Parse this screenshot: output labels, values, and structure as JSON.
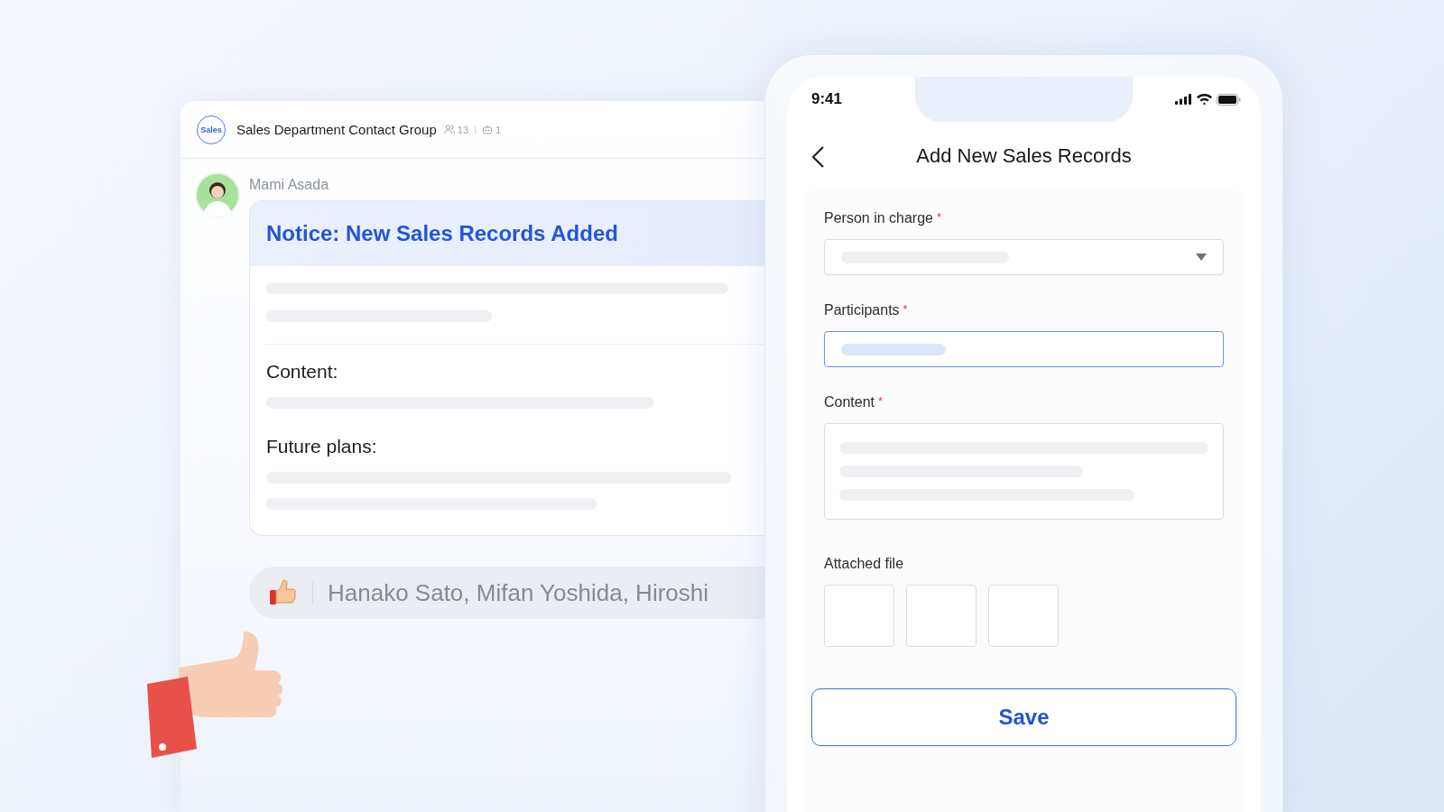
{
  "chat": {
    "group_badge": "Sales",
    "group_name": "Sales Department Contact Group",
    "member_count": "13",
    "bot_count": "1",
    "message": {
      "sender": "Mami Asada",
      "title": "Notice: New Sales Records Added",
      "sections": [
        {
          "heading": "Content:"
        },
        {
          "heading": "Future plans:"
        }
      ]
    },
    "reaction": {
      "names": "Hanako Sato, Mifan Yoshida, Hiroshi"
    }
  },
  "phone": {
    "time": "9:41",
    "title": "Add New Sales Records",
    "fields": [
      {
        "kind": "select",
        "label": "Person in charge",
        "required_mark": "*",
        "focused": false
      },
      {
        "kind": "input",
        "label": "Participants",
        "required_mark": "*",
        "focused": true
      },
      {
        "kind": "textarea",
        "label": "Content",
        "required_mark": "*",
        "focused": false
      },
      {
        "kind": "files",
        "label": "Attached file"
      }
    ],
    "save": "Save"
  }
}
